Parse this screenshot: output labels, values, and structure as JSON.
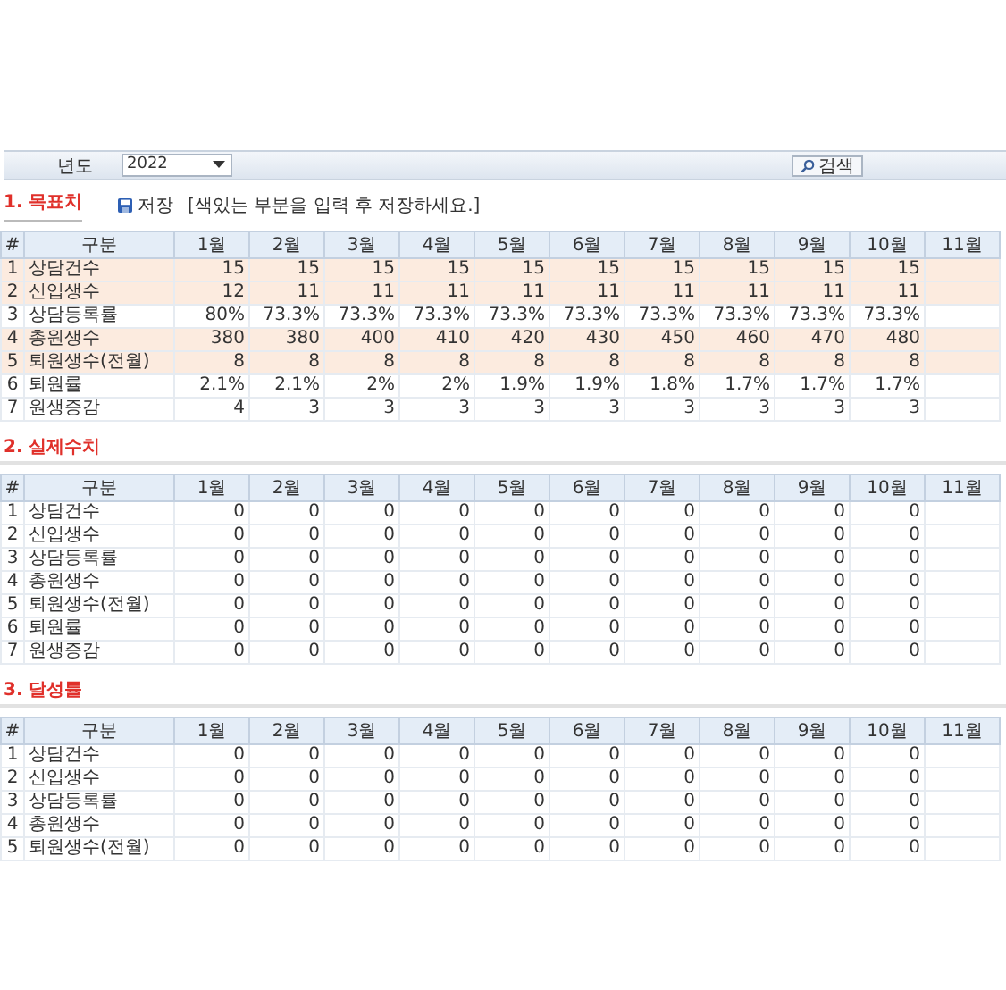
{
  "toolbar": {
    "year_label": "년도",
    "year_select": {
      "value": "2022"
    },
    "search_button": {
      "label": "검색"
    }
  },
  "sections": [
    {
      "title": "1. 목표치",
      "save_button": {
        "label": "저장"
      },
      "hint": "[색있는 부분을 입력 후 저장하세요.]",
      "columns": [
        "#",
        "구분",
        "1월",
        "2월",
        "3월",
        "4월",
        "5월",
        "6월",
        "7월",
        "8월",
        "9월",
        "10월",
        "11월"
      ],
      "rows": [
        {
          "no": "1",
          "label": "상담건수",
          "editable": true,
          "values": [
            "15",
            "15",
            "15",
            "15",
            "15",
            "15",
            "15",
            "15",
            "15",
            "15"
          ]
        },
        {
          "no": "2",
          "label": "신입생수",
          "editable": true,
          "values": [
            "12",
            "11",
            "11",
            "11",
            "11",
            "11",
            "11",
            "11",
            "11",
            "11"
          ]
        },
        {
          "no": "3",
          "label": "상담등록률",
          "editable": false,
          "values": [
            "80%",
            "73.3%",
            "73.3%",
            "73.3%",
            "73.3%",
            "73.3%",
            "73.3%",
            "73.3%",
            "73.3%",
            "73.3%"
          ]
        },
        {
          "no": "4",
          "label": "총원생수",
          "editable": true,
          "values": [
            "380",
            "380",
            "400",
            "410",
            "420",
            "430",
            "450",
            "460",
            "470",
            "480"
          ]
        },
        {
          "no": "5",
          "label": "퇴원생수(전월)",
          "editable": true,
          "values": [
            "8",
            "8",
            "8",
            "8",
            "8",
            "8",
            "8",
            "8",
            "8",
            "8"
          ]
        },
        {
          "no": "6",
          "label": "퇴원률",
          "editable": false,
          "values": [
            "2.1%",
            "2.1%",
            "2%",
            "2%",
            "1.9%",
            "1.9%",
            "1.8%",
            "1.7%",
            "1.7%",
            "1.7%"
          ]
        },
        {
          "no": "7",
          "label": "원생증감",
          "editable": false,
          "values": [
            "4",
            "3",
            "3",
            "3",
            "3",
            "3",
            "3",
            "3",
            "3",
            "3"
          ]
        }
      ]
    },
    {
      "title": "2. 실제수치",
      "columns": [
        "#",
        "구분",
        "1월",
        "2월",
        "3월",
        "4월",
        "5월",
        "6월",
        "7월",
        "8월",
        "9월",
        "10월",
        "11월"
      ],
      "rows": [
        {
          "no": "1",
          "label": "상담건수",
          "editable": false,
          "values": [
            "0",
            "0",
            "0",
            "0",
            "0",
            "0",
            "0",
            "0",
            "0",
            "0"
          ]
        },
        {
          "no": "2",
          "label": "신입생수",
          "editable": false,
          "values": [
            "0",
            "0",
            "0",
            "0",
            "0",
            "0",
            "0",
            "0",
            "0",
            "0"
          ]
        },
        {
          "no": "3",
          "label": "상담등록률",
          "editable": false,
          "values": [
            "0",
            "0",
            "0",
            "0",
            "0",
            "0",
            "0",
            "0",
            "0",
            "0"
          ]
        },
        {
          "no": "4",
          "label": "총원생수",
          "editable": false,
          "values": [
            "0",
            "0",
            "0",
            "0",
            "0",
            "0",
            "0",
            "0",
            "0",
            "0"
          ]
        },
        {
          "no": "5",
          "label": "퇴원생수(전월)",
          "editable": false,
          "values": [
            "0",
            "0",
            "0",
            "0",
            "0",
            "0",
            "0",
            "0",
            "0",
            "0"
          ]
        },
        {
          "no": "6",
          "label": "퇴원률",
          "editable": false,
          "values": [
            "0",
            "0",
            "0",
            "0",
            "0",
            "0",
            "0",
            "0",
            "0",
            "0"
          ]
        },
        {
          "no": "7",
          "label": "원생증감",
          "editable": false,
          "values": [
            "0",
            "0",
            "0",
            "0",
            "0",
            "0",
            "0",
            "0",
            "0",
            "0"
          ]
        }
      ]
    },
    {
      "title": "3. 달성률",
      "columns": [
        "#",
        "구분",
        "1월",
        "2월",
        "3월",
        "4월",
        "5월",
        "6월",
        "7월",
        "8월",
        "9월",
        "10월",
        "11월"
      ],
      "rows": [
        {
          "no": "1",
          "label": "상담건수",
          "editable": false,
          "values": [
            "0",
            "0",
            "0",
            "0",
            "0",
            "0",
            "0",
            "0",
            "0",
            "0"
          ]
        },
        {
          "no": "2",
          "label": "신입생수",
          "editable": false,
          "values": [
            "0",
            "0",
            "0",
            "0",
            "0",
            "0",
            "0",
            "0",
            "0",
            "0"
          ]
        },
        {
          "no": "3",
          "label": "상담등록률",
          "editable": false,
          "values": [
            "0",
            "0",
            "0",
            "0",
            "0",
            "0",
            "0",
            "0",
            "0",
            "0"
          ]
        },
        {
          "no": "4",
          "label": "총원생수",
          "editable": false,
          "values": [
            "0",
            "0",
            "0",
            "0",
            "0",
            "0",
            "0",
            "0",
            "0",
            "0"
          ]
        },
        {
          "no": "5",
          "label": "퇴원생수(전월)",
          "editable": false,
          "values": [
            "0",
            "0",
            "0",
            "0",
            "0",
            "0",
            "0",
            "0",
            "0",
            "0"
          ]
        }
      ]
    }
  ]
}
